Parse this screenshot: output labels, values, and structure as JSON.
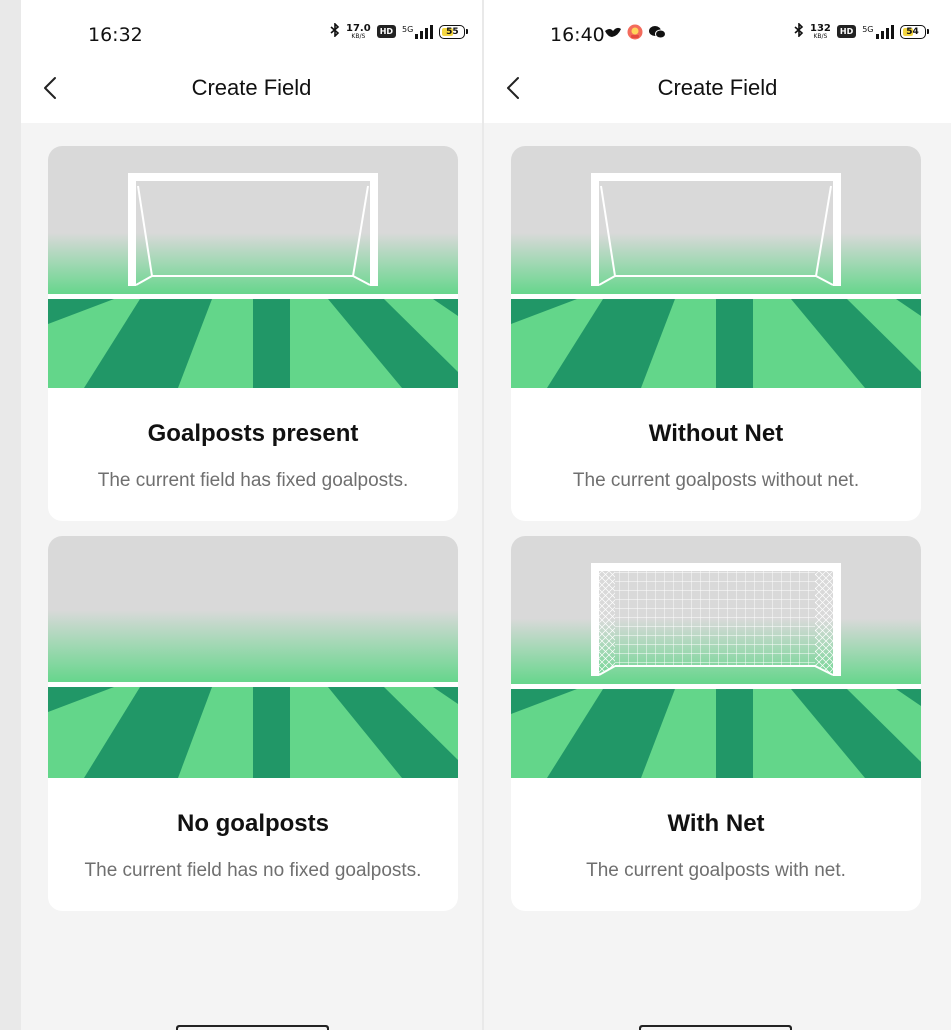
{
  "colors": {
    "grass_light": "#63d68a",
    "grass_dark": "#219767",
    "sky_gray": "#d9d9d9",
    "card_bg": "#ffffff",
    "page_bg": "#f4f4f4",
    "title_text": "#111111",
    "desc_text": "#6f6f6f"
  },
  "screens": [
    {
      "status_bar": {
        "time": "16:32",
        "net_speed": "17.0",
        "net_unit": "KB/S",
        "hd_badge": "HD",
        "signal_text": "5G",
        "battery_level": 55,
        "battery_label": "55",
        "left_icons": []
      },
      "header": {
        "title": "Create Field"
      },
      "cards": [
        {
          "title": "Goalposts present",
          "description": "The current field has fixed goalposts.",
          "image": "goal-frame"
        },
        {
          "title": "No goalposts",
          "description": "The current field has no fixed goalposts.",
          "image": "empty-field"
        }
      ]
    },
    {
      "status_bar": {
        "time": "16:40",
        "net_speed": "132",
        "net_unit": "KB/S",
        "hd_badge": "HD",
        "signal_text": "5G",
        "battery_level": 54,
        "battery_label": "54",
        "left_icons": [
          "bird-notification-icon",
          "app-notification-icon",
          "chat-notification-icon"
        ]
      },
      "header": {
        "title": "Create Field"
      },
      "cards": [
        {
          "title": "Without Net",
          "description": "The current goalposts without net.",
          "image": "goal-frame"
        },
        {
          "title": "With Net",
          "description": "The current goalposts with net.",
          "image": "goal-net"
        }
      ]
    }
  ]
}
